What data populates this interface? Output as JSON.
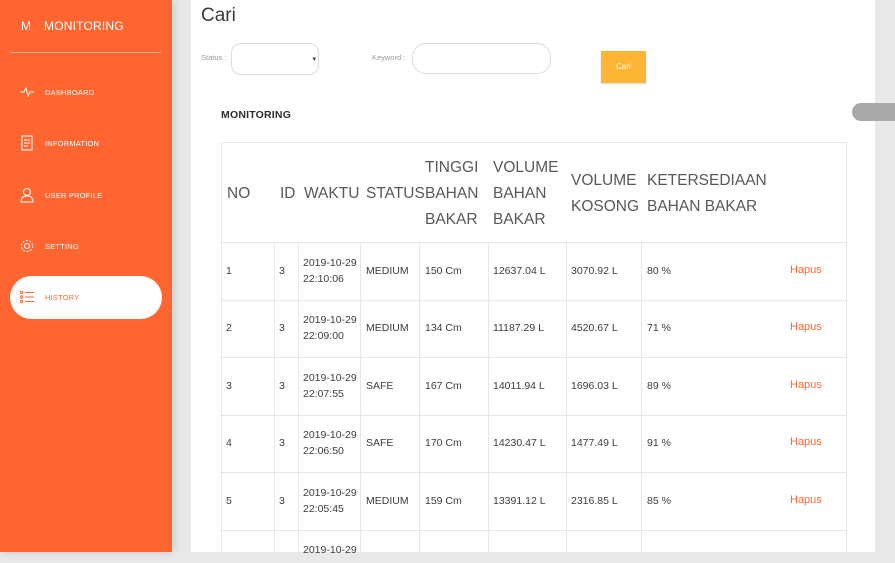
{
  "app": {
    "brand_mini": "M",
    "brand_name": "MONITORING"
  },
  "sidebar": {
    "items": [
      {
        "label": "DASHBOARD",
        "icon": "heartbeat-icon",
        "active": false
      },
      {
        "label": "INFORMATION",
        "icon": "document-icon",
        "active": false
      },
      {
        "label": "USER PROFILE",
        "icon": "user-icon",
        "active": false
      },
      {
        "label": "SETTING",
        "icon": "gear-icon",
        "active": false
      },
      {
        "label": "HISTORY",
        "icon": "list-icon",
        "active": true
      }
    ]
  },
  "filters": {
    "title": "Cari",
    "status_label": "Status :",
    "status_value": "",
    "keyword_label": "Keyword :",
    "keyword_value": "",
    "keyword_placeholder": "",
    "search_button": "Cari"
  },
  "table": {
    "title": "MONITORING",
    "headers": {
      "no": "NO",
      "id": "ID",
      "waktu": "WAKTU",
      "status": "STATUS",
      "tinggi_1": "TINGGI",
      "tinggi_2": "BAHAN",
      "tinggi_3": "BAKAR",
      "volbb_1": "VOLUME",
      "volbb_2": "BAHAN",
      "volbb_3": "BAKAR",
      "volk_1": "VOLUME",
      "volk_2": "KOSONG",
      "ket_1": "KETERSEDIAAN",
      "ket_2": "BAHAN BAKAR"
    },
    "rows": [
      {
        "no": "1",
        "id": "3",
        "date": "2019-10-29",
        "time": "22:10:06",
        "status": "MEDIUM",
        "tinggi": "150 Cm",
        "volume_bb": "12637.04 L",
        "volume_kosong": "3070.92 L",
        "ketersediaan": "80 %",
        "action": "Hapus"
      },
      {
        "no": "2",
        "id": "3",
        "date": "2019-10-29",
        "time": "22:09:00",
        "status": "MEDIUM",
        "tinggi": "134 Cm",
        "volume_bb": "11187.29 L",
        "volume_kosong": "4520.67 L",
        "ketersediaan": "71 %",
        "action": "Hapus"
      },
      {
        "no": "3",
        "id": "3",
        "date": "2019-10-29",
        "time": "22:07:55",
        "status": "SAFE",
        "tinggi": "167 Cm",
        "volume_bb": "14011.94 L",
        "volume_kosong": "1696.03 L",
        "ketersediaan": "89 %",
        "action": "Hapus"
      },
      {
        "no": "4",
        "id": "3",
        "date": "2019-10-29",
        "time": "22:06:50",
        "status": "SAFE",
        "tinggi": "170 Cm",
        "volume_bb": "14230.47 L",
        "volume_kosong": "1477.49 L",
        "ketersediaan": "91 %",
        "action": "Hapus"
      },
      {
        "no": "5",
        "id": "3",
        "date": "2019-10-29",
        "time": "22:05:45",
        "status": "MEDIUM",
        "tinggi": "159 Cm",
        "volume_bb": "13391.12 L",
        "volume_kosong": "2316.85 L",
        "ketersediaan": "85 %",
        "action": "Hapus"
      },
      {
        "no": "",
        "id": "",
        "date": "2019-10-29",
        "time": "",
        "status": "",
        "tinggi": "",
        "volume_bb": "",
        "volume_kosong": "",
        "ketersediaan": "",
        "action": ""
      }
    ]
  },
  "colors": {
    "sidebar": "#ff6531",
    "accent_button": "#fdb534",
    "link": "#ff6531"
  }
}
